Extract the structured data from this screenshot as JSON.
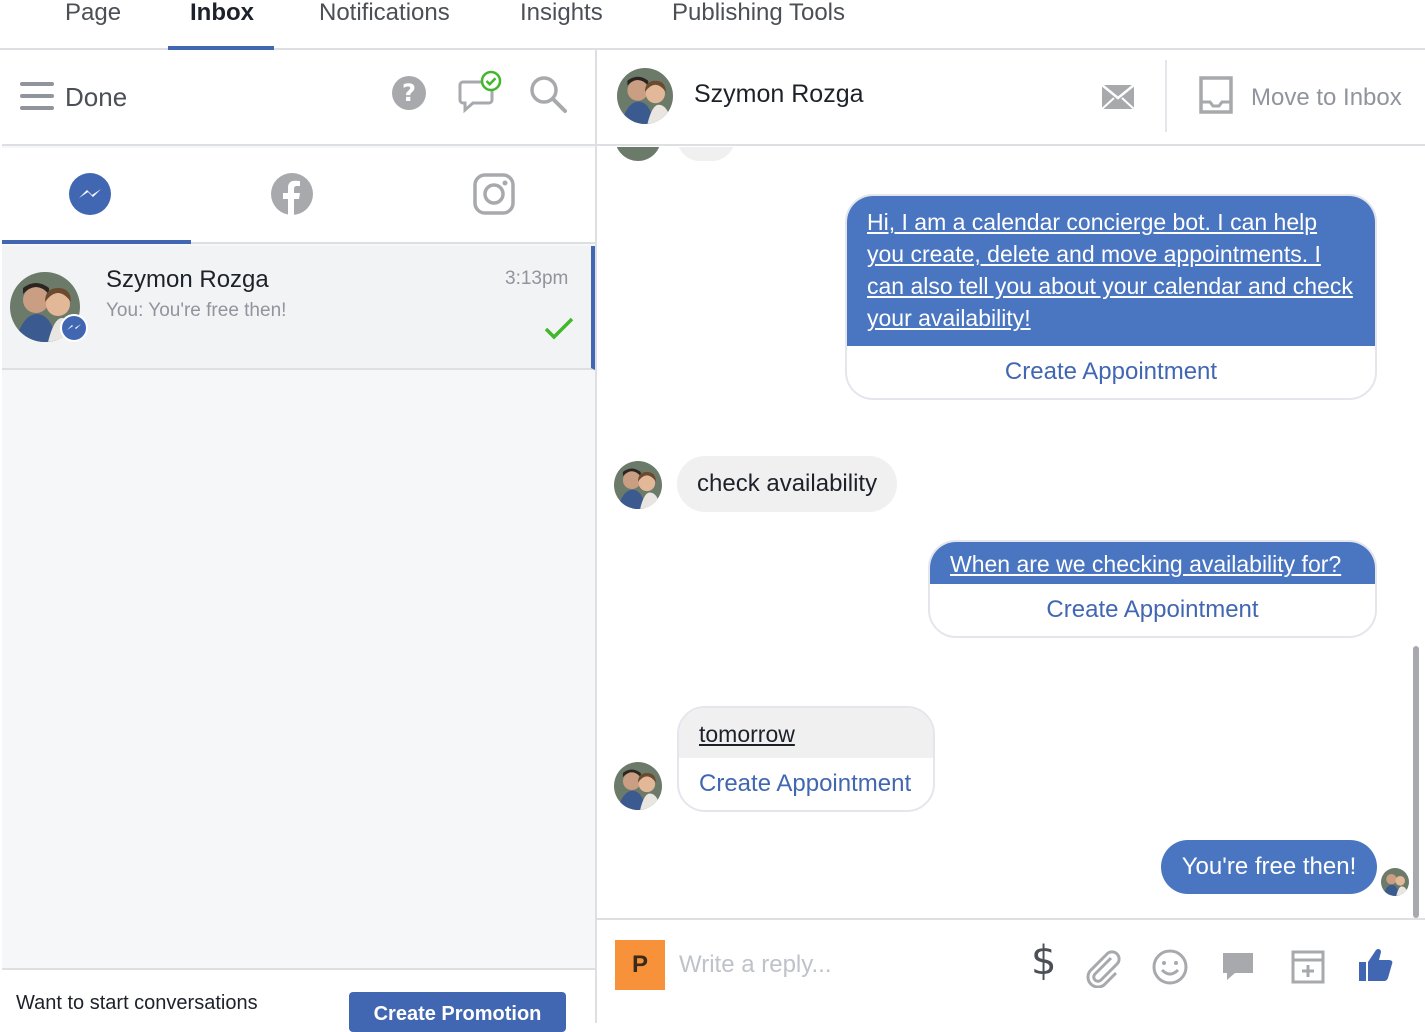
{
  "nav": {
    "tabs": [
      {
        "label": "Page"
      },
      {
        "label": "Inbox",
        "active": true
      },
      {
        "label": "Notifications"
      },
      {
        "label": "Insights"
      },
      {
        "label": "Publishing Tools"
      }
    ]
  },
  "toolbar": {
    "done_label": "Done"
  },
  "channels": {
    "active": "messenger",
    "items": [
      "messenger-icon",
      "facebook-icon",
      "instagram-icon"
    ]
  },
  "conversation_list": [
    {
      "name": "Szymon Rozga",
      "snippet": "You: You're free then!",
      "time": "3:13pm",
      "status": "sent-check"
    }
  ],
  "left_footer": {
    "text": "Want to start conversations",
    "button": "Create Promotion"
  },
  "thread": {
    "contact_name": "Szymon Rozga",
    "move_to_inbox_label": "Move to Inbox",
    "messages": [
      {
        "from": "page",
        "text": "Hi, I am a calendar concierge bot. I can help you create, delete and move appointments. I can also tell you about your calendar and check your availability!",
        "button": "Create Appointment"
      },
      {
        "from": "user",
        "text": "check availability"
      },
      {
        "from": "page",
        "text": "When are we checking availability for?",
        "button": "Create Appointment"
      },
      {
        "from": "user",
        "text": "tomorrow",
        "button": "Create Appointment"
      },
      {
        "from": "page",
        "text": "You're free then!"
      }
    ]
  },
  "composer": {
    "page_initial": "P",
    "placeholder": "Write a reply..."
  },
  "colors": {
    "accent": "#4267b2",
    "outgoing_bubble": "#4a76c1",
    "incoming_bubble": "#f1f0f0",
    "check_green": "#42b72a",
    "page_badge": "#f7923a"
  }
}
